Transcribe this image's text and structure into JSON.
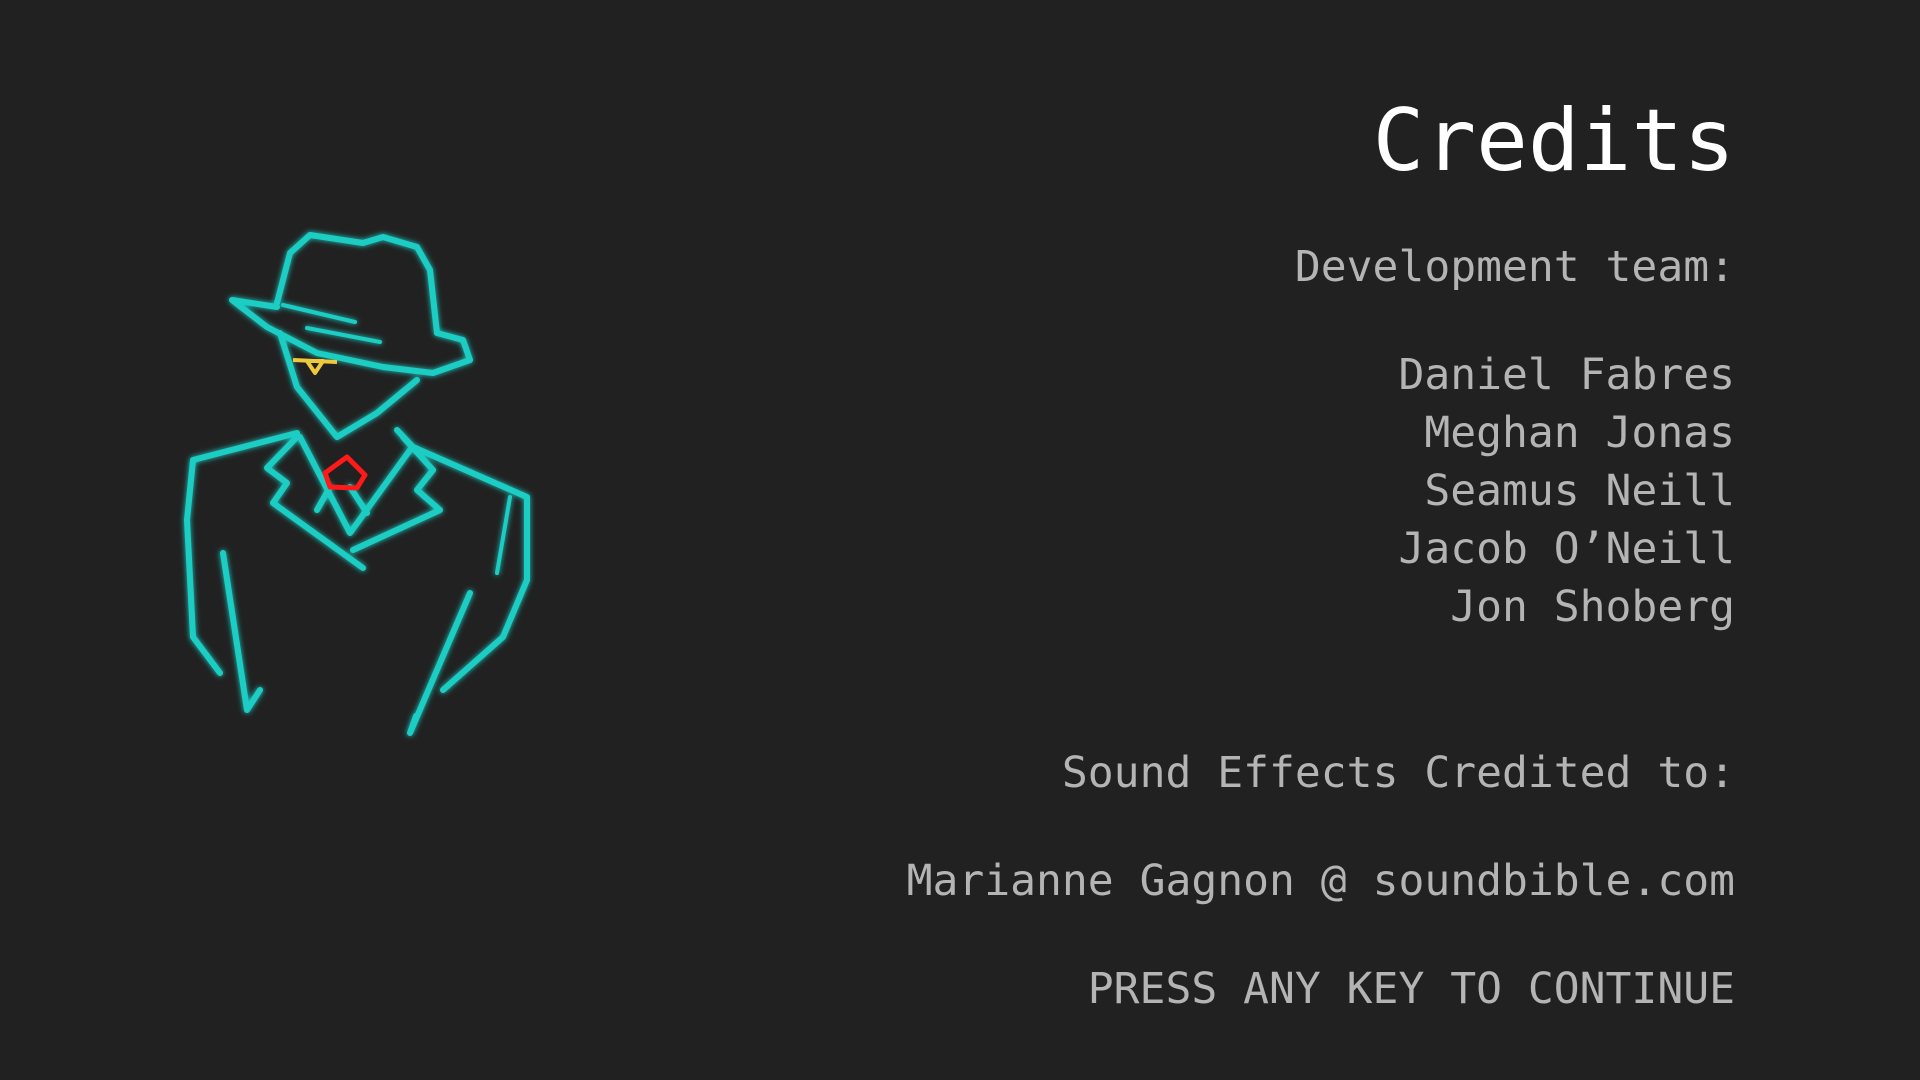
{
  "title": "Credits",
  "development": {
    "heading": "Development team:",
    "members": [
      "Daniel Fabres",
      "Meghan Jonas",
      "Seamus Neill",
      "Jacob O’Neill",
      "Jon Shoberg"
    ]
  },
  "sound": {
    "heading": "Sound Effects Credited to:",
    "credit": "Marianne Gagnon @ soundbible.com"
  },
  "prompt": "PRESS ANY KEY TO CONTINUE",
  "colors": {
    "background": "#212121",
    "figure_outline": "#1ecdc4",
    "eye": "#f0c93a",
    "gem": "#ff1a1a",
    "title_text": "#ffffff",
    "body_text": "#b4b4b4"
  },
  "illustration": "detective-figure-in-fedora"
}
